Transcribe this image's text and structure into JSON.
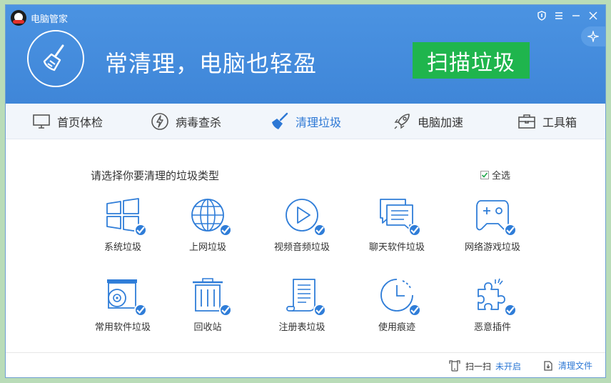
{
  "window": {
    "app_title": "电脑管家",
    "controls": [
      "shield-icon",
      "menu-icon",
      "minimize-icon",
      "close-icon"
    ]
  },
  "header": {
    "headline": "常清理，电脑也轻盈",
    "scan_button": "扫描垃圾"
  },
  "nav": {
    "tabs": [
      {
        "label": "首页体检",
        "icon": "monitor-icon"
      },
      {
        "label": "病毒查杀",
        "icon": "lightning-icon"
      },
      {
        "label": "清理垃圾",
        "icon": "broom-icon",
        "active": true
      },
      {
        "label": "电脑加速",
        "icon": "rocket-icon"
      },
      {
        "label": "工具箱",
        "icon": "toolbox-icon"
      }
    ]
  },
  "content": {
    "prompt": "请选择你要清理的垃圾类型",
    "select_all": "全选",
    "tiles": [
      {
        "label": "系统垃圾",
        "icon": "windows-icon",
        "checked": true
      },
      {
        "label": "上网垃圾",
        "icon": "globe-icon",
        "checked": true
      },
      {
        "label": "视频音频垃圾",
        "icon": "play-icon",
        "checked": true
      },
      {
        "label": "聊天软件垃圾",
        "icon": "chat-icon",
        "checked": true
      },
      {
        "label": "网络游戏垃圾",
        "icon": "gamepad-icon",
        "checked": true
      },
      {
        "label": "常用软件垃圾",
        "icon": "disc-drive-icon",
        "checked": true
      },
      {
        "label": "回收站",
        "icon": "trash-icon",
        "checked": true
      },
      {
        "label": "注册表垃圾",
        "icon": "scroll-icon",
        "checked": true
      },
      {
        "label": "使用痕迹",
        "icon": "clock-icon",
        "checked": true
      },
      {
        "label": "恶意插件",
        "icon": "puzzle-icon",
        "checked": true
      }
    ]
  },
  "footer": {
    "scan_label": "扫一扫",
    "scan_status": "未开启",
    "clean_files": "清理文件"
  },
  "colors": {
    "header_blue": "#4b93e2",
    "accent_blue": "#2f7dd8",
    "scan_green": "#1fb54d"
  }
}
